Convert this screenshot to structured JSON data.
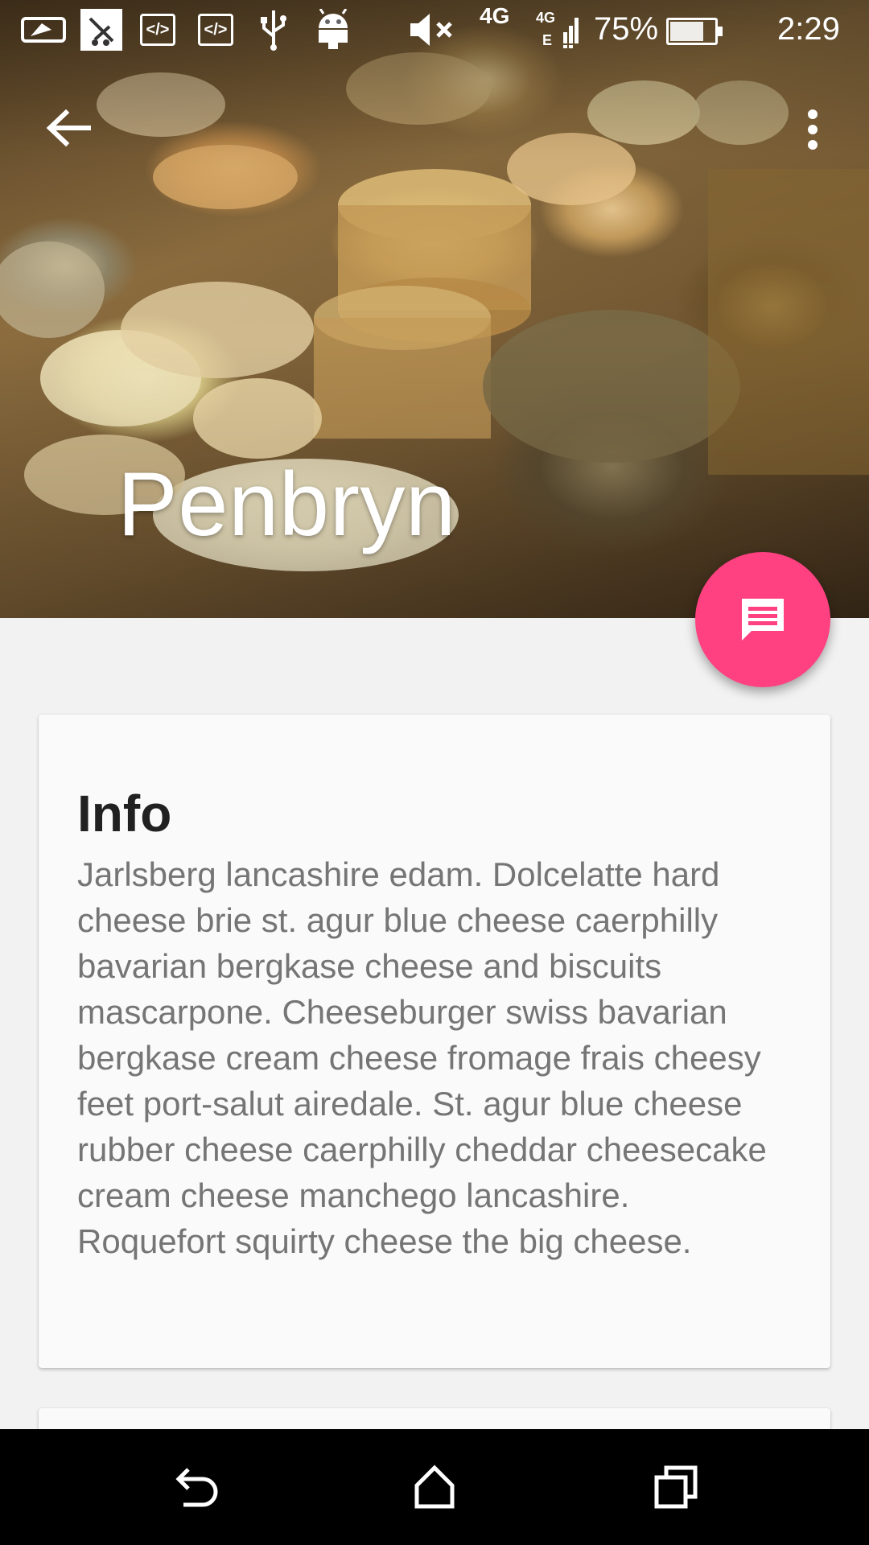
{
  "status_bar": {
    "time": "2:29",
    "battery_text": "75%",
    "network": "4G",
    "signal_label": "4G",
    "signal_sub": "E",
    "icons": [
      "vpn-key-icon",
      "no-call-icon",
      "code-icon",
      "code-icon",
      "usb-icon",
      "android-debug-icon",
      "volume-mute-icon",
      "signal-icon",
      "battery-charging-icon"
    ]
  },
  "toolbar": {
    "back_icon": "arrow-back-icon",
    "menu_icon": "more-vert-icon"
  },
  "header": {
    "title": "Penbryn"
  },
  "fab": {
    "icon": "message-icon",
    "color": "#ff4081"
  },
  "card": {
    "title": "Info",
    "body": "Jarlsberg lancashire edam. Dolcelatte hard cheese brie st. agur blue cheese caerphilly bavarian bergkase cheese and biscuits mascarpone. Cheeseburger swiss bavarian bergkase cream cheese fromage frais cheesy feet port-salut airedale. St. agur blue cheese rubber cheese caerphilly cheddar cheesecake cream cheese manchego lancashire. Roquefort squirty cheese the big cheese."
  },
  "nav_bar": {
    "back_icon": "nav-back-icon",
    "home_icon": "home-icon",
    "recents_icon": "recents-icon"
  }
}
